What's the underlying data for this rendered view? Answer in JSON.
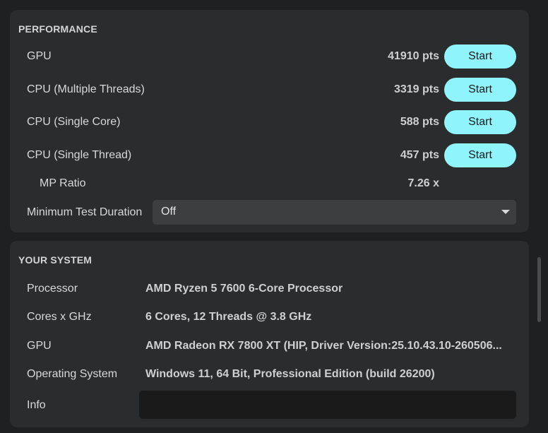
{
  "performance": {
    "title": "PERFORMANCE",
    "rows": [
      {
        "label": "GPU",
        "score": "41910 pts",
        "button": "Start"
      },
      {
        "label": "CPU (Multiple Threads)",
        "score": "3319 pts",
        "button": "Start"
      },
      {
        "label": "CPU (Single Core)",
        "score": "588 pts",
        "button": "Start"
      },
      {
        "label": "CPU (Single Thread)",
        "score": "457 pts",
        "button": "Start"
      }
    ],
    "mp_ratio": {
      "label": "MP Ratio",
      "value": "7.26 x"
    },
    "min_duration": {
      "label": "Minimum Test Duration",
      "value": "Off"
    }
  },
  "system": {
    "title": "YOUR SYSTEM",
    "rows": [
      {
        "label": "Processor",
        "value": "AMD Ryzen 5 7600 6-Core Processor"
      },
      {
        "label": "Cores x GHz",
        "value": "6 Cores, 12 Threads @ 3.8 GHz"
      },
      {
        "label": "GPU",
        "value": "AMD Radeon RX 7800 XT (HIP, Driver Version:25.10.43.10-260506..."
      },
      {
        "label": "Operating System",
        "value": "Windows 11, 64 Bit, Professional Edition (build 26200)"
      }
    ],
    "info": {
      "label": "Info",
      "value": ""
    }
  },
  "colors": {
    "accent": "#8ff4fc",
    "panel": "#2a2c2e",
    "background": "#1e2022"
  }
}
